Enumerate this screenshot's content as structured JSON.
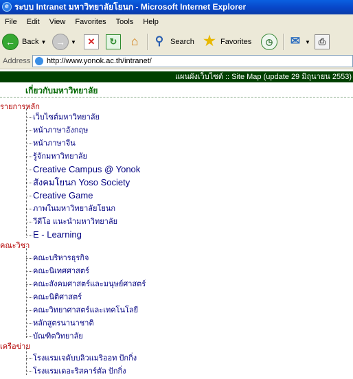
{
  "window": {
    "title": "ระบบ Intranet มหาวิทยาลัยโยนก - Microsoft Internet Explorer"
  },
  "menu": [
    "File",
    "Edit",
    "View",
    "Favorites",
    "Tools",
    "Help"
  ],
  "toolbar": {
    "back_label": "Back",
    "search_label": "Search",
    "favorites_label": "Favorites"
  },
  "address": {
    "label": "Address",
    "url": "http://www.yonok.ac.th/intranet/"
  },
  "page": {
    "sitemap_header": "แผนผังเว็บไซต์ :: Site Map (update 29 มิถุนายน 2553)",
    "about_heading": "เกี่ยวกับมหาวิทยาลัย",
    "sections": [
      {
        "title": "รายการหลัก",
        "items": [
          "เว็บไซต์มหาวิทยาลัย",
          "หน้าภาษาอังกฤษ",
          "หน้าภาษาจีน",
          "รู้จักมหาวิทยาลัย",
          "Creative Campus @ Yonok",
          "สังคมโยนก Yoso Society",
          "Creative Game",
          "ภาพในมหาวิทยาลัยโยนก",
          "วีดีโอ แนะนำมหาวิทยาลัย",
          "E - Learning"
        ]
      },
      {
        "title": "คณะวิชา",
        "items": [
          "คณะบริหารธุรกิจ",
          "คณะนิเทศศาสตร์",
          "คณะสังคมศาสตร์และมนุษย์ศาสตร์",
          "คณะนิติศาสตร์",
          "คณะวิทยาศาสตร์และเทคโนโลยี",
          "หลักสูตรนานาชาติ",
          "บัณฑิตวิทยาลัย"
        ]
      },
      {
        "title": "เครือข่าย",
        "items": [
          "โรงแรมเจดับบลิวแมริออท ปักกิ่ง",
          "โรงแรมเดอะริสคาร์ตัล ปักกิ่ง"
        ]
      }
    ]
  }
}
